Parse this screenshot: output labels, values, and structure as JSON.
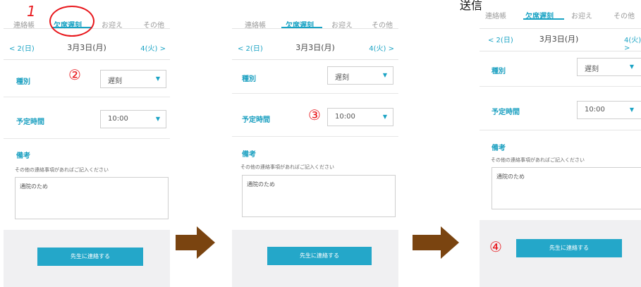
{
  "caption": "送信",
  "tabs": [
    "連絡帳",
    "欠席遅刻",
    "お迎え",
    "その他"
  ],
  "date": {
    "prev": "< 2(日)",
    "current": "3月3日(月)",
    "next": "4(火) >"
  },
  "form": {
    "type_label": "種別",
    "type_value": "遅刻",
    "time_label": "予定時間",
    "time_value": "10:00",
    "note_title": "備考",
    "note_help": "その他の連絡事項があればご記入ください",
    "note_value": "通院のため",
    "submit_label": "先生に連絡する"
  },
  "annotations": {
    "n1": "1",
    "n2": "②",
    "n3": "③",
    "n4": "④"
  },
  "colors": {
    "accent": "#1aa3c4",
    "annotation": "#e8161b",
    "arrow": "#7a4410"
  }
}
